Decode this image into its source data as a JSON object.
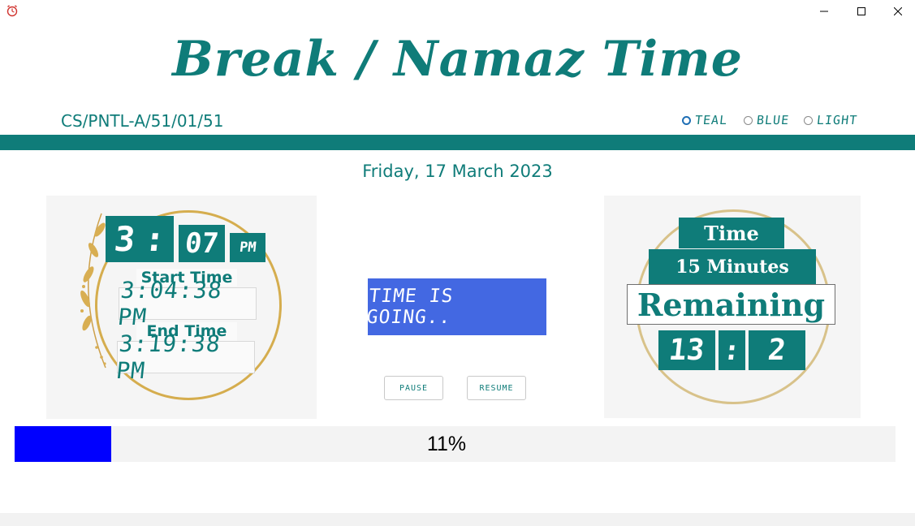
{
  "window": {
    "app_icon": "alarm-clock-icon",
    "controls": [
      "minimize-icon",
      "maximize-icon",
      "close-icon"
    ]
  },
  "header": {
    "title": "Break / Namaz Time",
    "code": "CS/PNTL-A/51/01/51"
  },
  "themes": {
    "selected": "TEAL",
    "options": [
      "TEAL",
      "BLUE",
      "LIGHT"
    ]
  },
  "colors": {
    "accent": "#0f7c79",
    "status_banner": "#4368e2",
    "progress_fill": "#0000ff",
    "ring_gold": "#d5ad4e"
  },
  "date": "Friday, 17 March 2023",
  "clock": {
    "hour": "3",
    "separator": ":",
    "minute": "07",
    "ampm": "PM",
    "start_label": "Start Time",
    "start_time": "3:04:38 PM",
    "end_label": "End Time",
    "end_time": "3:19:38 PM"
  },
  "status": {
    "text": "TIME IS GOING..",
    "pause_label": "PAUSE",
    "resume_label": "RESUME"
  },
  "remaining": {
    "time_label": "Time",
    "duration_label": "15 Minutes",
    "remaining_label": "Remaining",
    "minutes": "13",
    "separator": ":",
    "seconds": "2"
  },
  "progress": {
    "percent": 11,
    "label": "11%"
  }
}
